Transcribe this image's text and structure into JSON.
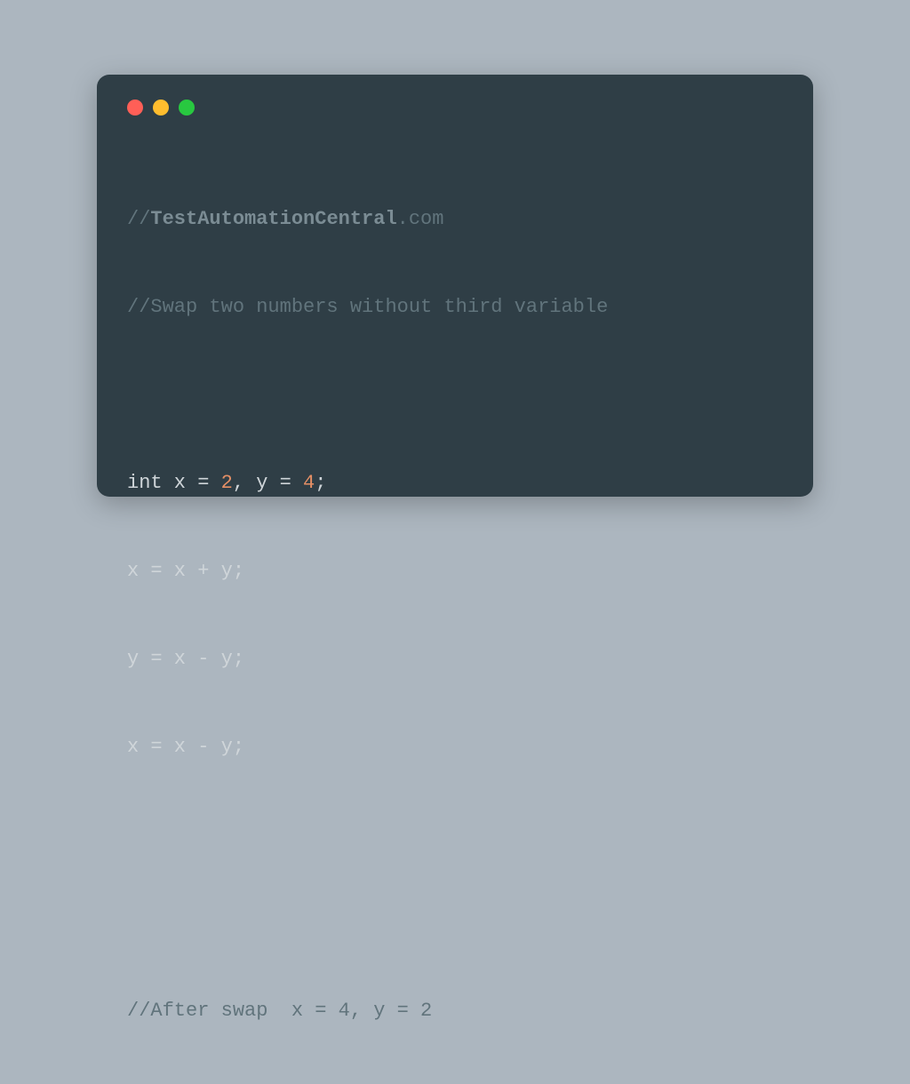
{
  "code": {
    "comment1_prefix": "//",
    "comment1_bold": "TestAutomationCentral",
    "comment1_suffix": ".com",
    "comment2": "//Swap two numbers without third variable",
    "decl_keyword": "int",
    "decl_part1": " x = ",
    "decl_num1": "2",
    "decl_part2": ", y = ",
    "decl_num2": "4",
    "decl_part3": ";",
    "line4": "x = x + y;",
    "line5": "y = x - y;",
    "line6": "x = x - y;",
    "comment3": "//After swap  x = 4, y = 2"
  }
}
